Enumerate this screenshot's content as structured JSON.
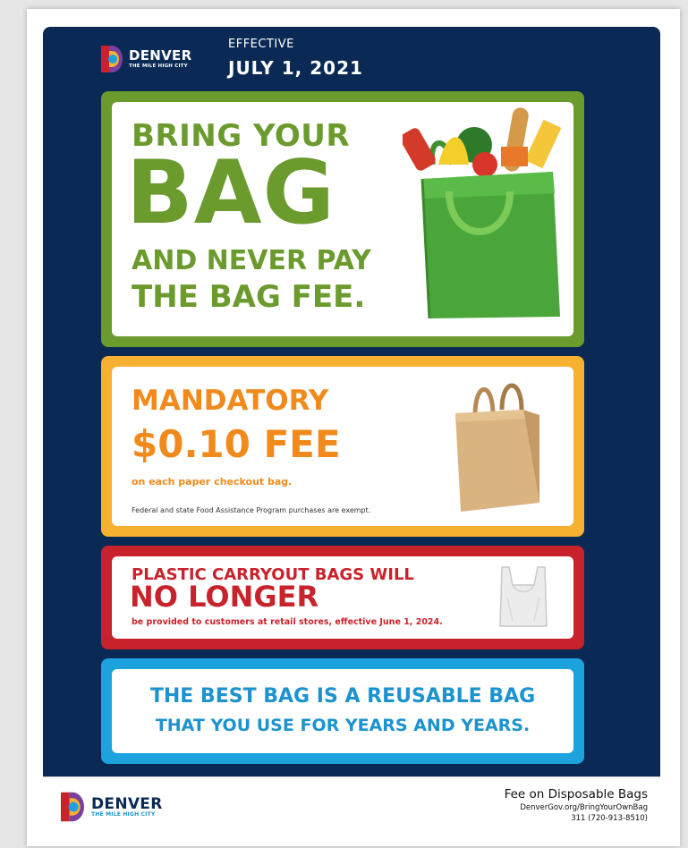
{
  "header": {
    "logo_name": "DENVER",
    "logo_tagline": "THE MILE HIGH CITY",
    "effective_label": "EFFECTIVE",
    "effective_date": "JULY 1, 2021"
  },
  "panel_bring": {
    "line1": "BRING YOUR",
    "line2": "BAG",
    "line3": "AND NEVER PAY",
    "line4": "THE BAG FEE."
  },
  "panel_fee": {
    "line1": "MANDATORY",
    "line2": "$0.10 FEE",
    "line3": "on each paper checkout bag.",
    "note": "Federal and state Food Assistance Program purchases are exempt."
  },
  "panel_plastic": {
    "line1": "PLASTIC CARRYOUT BAGS WILL",
    "line2": "NO LONGER",
    "line3": "be provided to customers at retail stores, effective June 1, 2024."
  },
  "panel_reusable": {
    "line1": "THE BEST BAG IS A REUSABLE BAG",
    "line2": "THAT YOU USE FOR YEARS AND YEARS."
  },
  "footer": {
    "logo_name": "DENVER",
    "logo_tagline": "THE MILE HIGH CITY",
    "title": "Fee on Disposable Bags",
    "url": "DenverGov.org/BringYourOwnBag",
    "phone": "311 (720-913-8510)"
  },
  "colors": {
    "navy": "#0a2a55",
    "green": "#6b9a2d",
    "orange": "#f08a1c",
    "red": "#c8232c",
    "blue": "#1ca3de"
  },
  "icons": [
    "denver-logo-icon",
    "grocery-bag-image",
    "paper-bag-image",
    "plastic-bag-image"
  ]
}
